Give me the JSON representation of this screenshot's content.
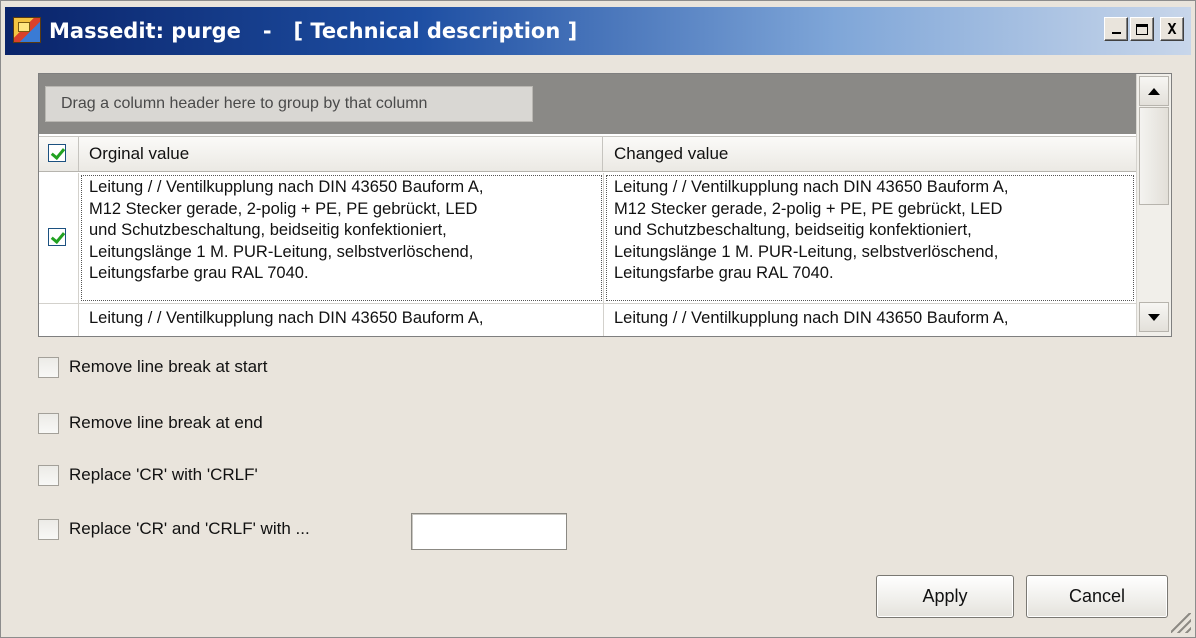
{
  "window": {
    "title": "Massedit: purge   -   [ Technical description ]",
    "title_controls": {
      "minimize": "_",
      "maximize": "□",
      "close": "X"
    }
  },
  "grid": {
    "group_hint": "Drag a column header here to group by that column",
    "select_all_checked": true,
    "columns": {
      "original": "Orginal value",
      "changed": "Changed value"
    },
    "rows": [
      {
        "checked": true,
        "original": "Leitung /  / Ventilkupplung nach DIN 43650 Bauform A,\nM12 Stecker gerade, 2-polig + PE, PE gebrückt, LED\nund Schutzbeschaltung, beidseitig konfektioniert,\nLeitungslänge 1 M. PUR-Leitung, selbstverlöschend,\nLeitungsfarbe grau RAL 7040.",
        "changed": "Leitung /  / Ventilkupplung nach DIN 43650 Bauform A,\nM12 Stecker gerade, 2-polig + PE, PE gebrückt, LED\nund Schutzbeschaltung, beidseitig konfektioniert,\nLeitungslänge 1 M. PUR-Leitung, selbstverlöschend,\nLeitungsfarbe grau RAL 7040."
      },
      {
        "checked": false,
        "original": "Leitung /  / Ventilkupplung nach DIN 43650 Bauform A,",
        "changed": "Leitung /  / Ventilkupplung nach DIN 43650 Bauform A,"
      }
    ]
  },
  "options": {
    "remove_start": {
      "label": "Remove line break at start",
      "checked": false
    },
    "remove_end": {
      "label": "Remove line break at end",
      "checked": false
    },
    "replace_cr": {
      "label": "Replace 'CR' with 'CRLF'",
      "checked": false
    },
    "replace_cr_crlf": {
      "label": "Replace 'CR' and 'CRLF' with ...",
      "checked": false,
      "value": ""
    }
  },
  "buttons": {
    "apply": "Apply",
    "cancel": "Cancel"
  }
}
